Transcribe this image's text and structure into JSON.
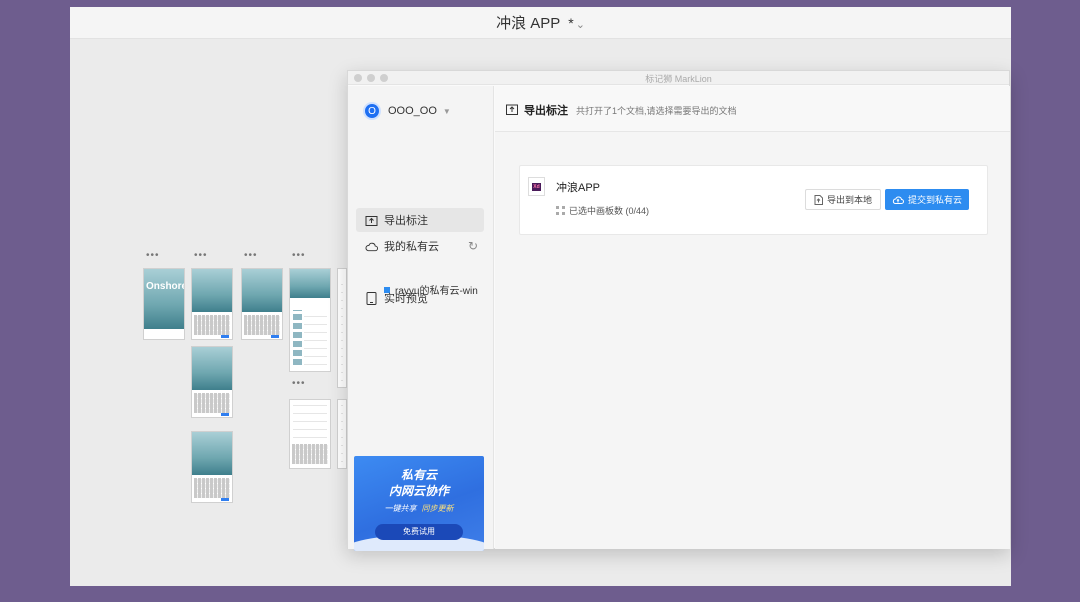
{
  "host": {
    "title": "冲浪 APP",
    "modified": "*"
  },
  "artboards": {
    "logo_text": "Onshore"
  },
  "marklion": {
    "window_title": "标记狮 MarkLion",
    "user": {
      "avatar_letter": "O",
      "name": "OOO_OO"
    },
    "nav": [
      {
        "label": "导出标注",
        "icon": "export-icon",
        "active": true
      },
      {
        "label": "我的私有云",
        "icon": "cloud-icon",
        "active": false
      },
      {
        "label": "实时预览",
        "icon": "tablet-icon",
        "active": false
      }
    ],
    "cloud_sub_item": "rayyu的私有云-win",
    "banner": {
      "line1": "私有云",
      "line2": "内网云协作",
      "tag_a": "一键共享",
      "tag_b": "同步更新",
      "button": "免费试用"
    },
    "header": {
      "title": "导出标注",
      "subtitle": "共打开了1个文档,请选择需要导出的文档"
    },
    "document": {
      "icon_text": "Xd",
      "name": "冲浪APP",
      "selection": "已选中画板数 (0/44)",
      "export_local": "导出到本地",
      "submit_cloud": "提交到私有云"
    }
  },
  "colors": {
    "background": "#6e5d8e",
    "accent": "#2d8cf0",
    "banner": "#2f6fe0"
  }
}
